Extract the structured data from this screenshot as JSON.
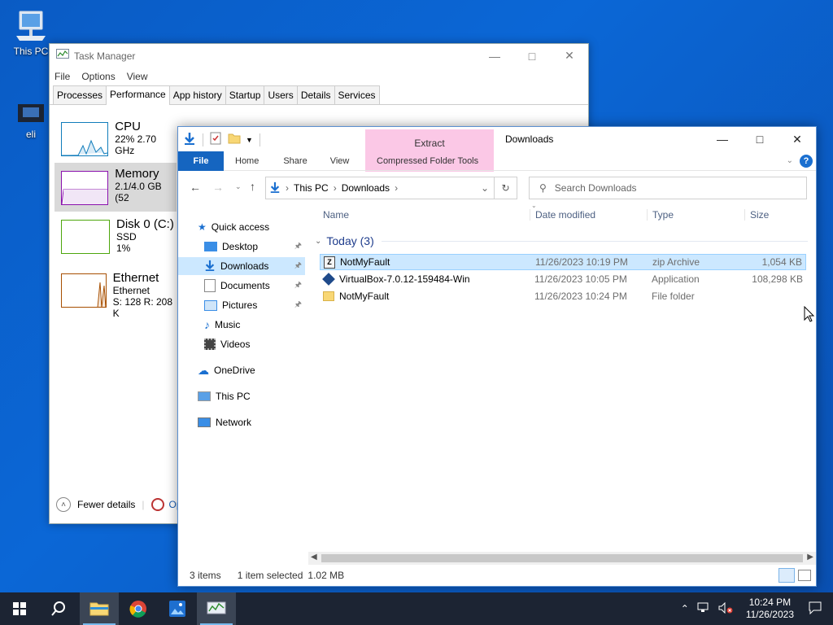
{
  "desktop": {
    "icons": [
      {
        "label": "This PC"
      },
      {
        "label": "eli"
      }
    ]
  },
  "task_manager": {
    "title": "Task Manager",
    "menu": [
      "File",
      "Options",
      "View"
    ],
    "tabs": [
      "Processes",
      "Performance",
      "App history",
      "Startup",
      "Users",
      "Details",
      "Services"
    ],
    "active_tab": "Performance",
    "perf": [
      {
        "name": "CPU",
        "line1": "22% 2.70 GHz",
        "line2": ""
      },
      {
        "name": "Memory",
        "line1": "2.1/4.0 GB (52",
        "line2": ""
      },
      {
        "name": "Disk 0 (C:)",
        "line1": "SSD",
        "line2": "1%"
      },
      {
        "name": "Ethernet",
        "line1": "Ethernet",
        "line2": "S: 128  R: 208 K"
      }
    ],
    "fewer_details": "Fewer details",
    "open_link": "Op"
  },
  "explorer": {
    "ribbon_extract": "Extract",
    "caption": "Downloads",
    "ribbon_tabs": [
      "File",
      "Home",
      "Share",
      "View",
      "Compressed Folder Tools"
    ],
    "address": [
      "This PC",
      "Downloads"
    ],
    "search_placeholder": "Search Downloads",
    "nav": {
      "quick_access": "Quick access",
      "desktop": "Desktop",
      "downloads": "Downloads",
      "documents": "Documents",
      "pictures": "Pictures",
      "music": "Music",
      "videos": "Videos",
      "onedrive": "OneDrive",
      "this_pc": "This PC",
      "network": "Network"
    },
    "columns": [
      "Name",
      "Date modified",
      "Type",
      "Size"
    ],
    "group": "Today (3)",
    "files": [
      {
        "name": "NotMyFault",
        "date": "11/26/2023 10:19 PM",
        "type": "zip Archive",
        "size": "1,054 KB"
      },
      {
        "name": "VirtualBox-7.0.12-159484-Win",
        "date": "11/26/2023 10:05 PM",
        "type": "Application",
        "size": "108,298 KB"
      },
      {
        "name": "NotMyFault",
        "date": "11/26/2023 10:24 PM",
        "type": "File folder",
        "size": ""
      }
    ],
    "status": {
      "items": "3 items",
      "selected": "1 item selected",
      "size": "1.02 MB"
    }
  },
  "taskbar": {
    "time": "10:24 PM",
    "date": "11/26/2023"
  }
}
